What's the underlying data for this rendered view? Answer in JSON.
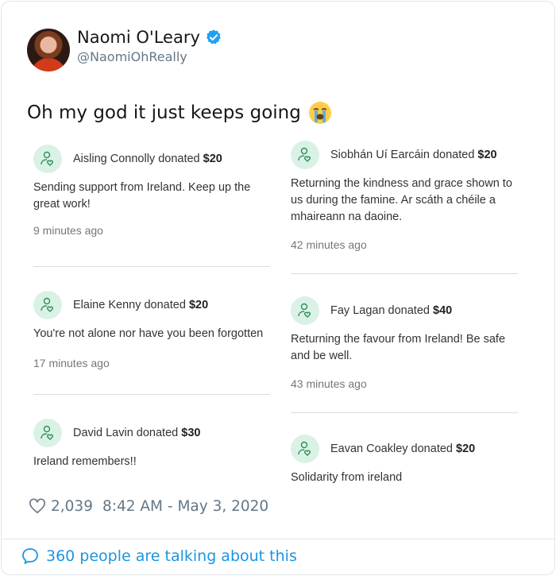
{
  "author": {
    "name": "Naomi O'Leary",
    "handle": "@NaomiOhReally",
    "verified": true
  },
  "tweet": {
    "text": "Oh my god it just keeps going",
    "emoji": "loudly-crying-face"
  },
  "donations_left": [
    {
      "donor": "Aisling Connolly donated",
      "amount": "$20",
      "message": "Sending support from Ireland. Keep up the great work!",
      "time": "9 minutes ago"
    },
    {
      "donor": "Elaine Kenny donated",
      "amount": "$20",
      "message": "You're not alone nor have you been forgotten",
      "time": "17 minutes ago"
    },
    {
      "donor": "David Lavin donated",
      "amount": "$30",
      "message": "Ireland remembers!!",
      "time": ""
    }
  ],
  "donations_right": [
    {
      "donor": "Siobhán Uí Earcáin donated",
      "amount": "$20",
      "message": "Returning the kindness and grace shown to us during the famine. Ar scáth a chéile a mhaireann na daoine.",
      "time": "42 minutes ago"
    },
    {
      "donor": "Fay Lagan donated",
      "amount": "$40",
      "message": "Returning the favour from Ireland! Be safe and be well.",
      "time": "43 minutes ago"
    },
    {
      "donor": "Eavan Coakley donated",
      "amount": "$20",
      "message": "Solidarity from ireland",
      "time": ""
    }
  ],
  "meta": {
    "likes": "2,039",
    "timestamp": "8:42 AM - May 3, 2020"
  },
  "footer": {
    "text": "360 people are talking about this"
  },
  "colors": {
    "link": "#1b95e0",
    "verified": "#1da1f2",
    "donation_icon_bg": "#daf2e6",
    "donation_icon_stroke": "#2f8f5b"
  }
}
